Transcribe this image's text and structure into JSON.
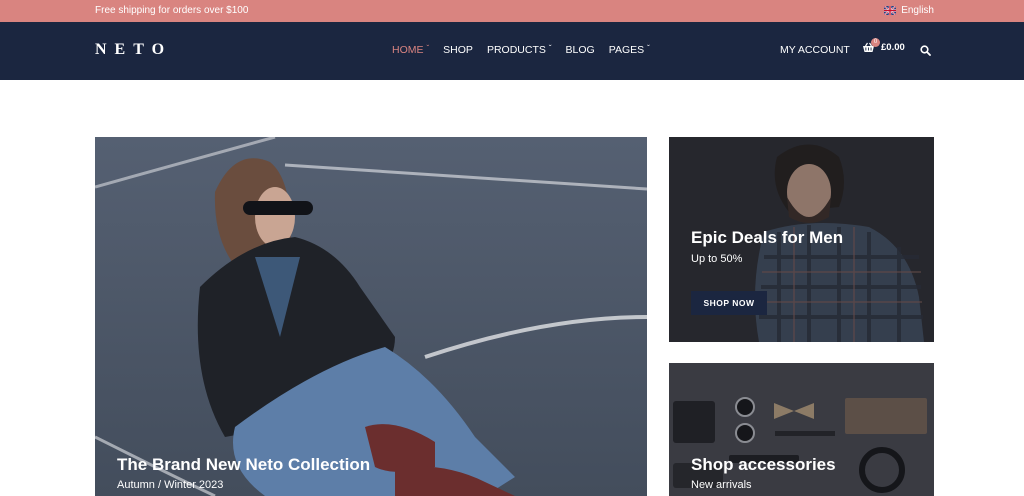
{
  "promo": {
    "text": "Free shipping for orders over $100",
    "language": "English"
  },
  "header": {
    "logo": "NETO",
    "nav": [
      {
        "label": "HOME",
        "has_dropdown": true,
        "active": true
      },
      {
        "label": "SHOP",
        "has_dropdown": false,
        "active": false
      },
      {
        "label": "PRODUCTS",
        "has_dropdown": true,
        "active": false
      },
      {
        "label": "BLOG",
        "has_dropdown": false,
        "active": false
      },
      {
        "label": "PAGES",
        "has_dropdown": true,
        "active": false
      }
    ],
    "account_label": "MY ACCOUNT",
    "cart_count": "0",
    "cart_total": "£0.00"
  },
  "banners": {
    "main": {
      "title": "The Brand New Neto Collection",
      "subtitle": "Autumn / Winter 2023"
    },
    "men": {
      "title": "Epic Deals for Men",
      "subtitle": "Up to 50%",
      "button": "SHOP NOW"
    },
    "accessories": {
      "title": "Shop accessories",
      "subtitle": "New arrivals"
    }
  },
  "colors": {
    "promo_bg": "#d98480",
    "header_bg": "#1b2640",
    "accent": "#d98480"
  },
  "icons": {
    "language": "uk-flag-icon",
    "dropdown": "chevron-down-icon",
    "cart": "shopping-basket-icon",
    "search": "search-icon"
  }
}
